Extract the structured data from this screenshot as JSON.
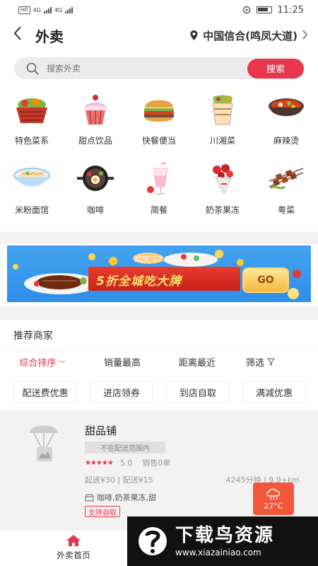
{
  "status_bar": {
    "left": "HD",
    "signal1": "4G",
    "signal2": "4G",
    "time": "11:25"
  },
  "header": {
    "back": "<",
    "title": "外卖",
    "location": "中国信合(鸣凤大道)"
  },
  "search": {
    "placeholder": "搜索外卖",
    "button": "搜索"
  },
  "categories": [
    {
      "label": "特色菜系",
      "icon": "basket-icon"
    },
    {
      "label": "甜点饮品",
      "icon": "cupcake-icon"
    },
    {
      "label": "快餐便当",
      "icon": "burger-icon"
    },
    {
      "label": "川湘菜",
      "icon": "salad-cup-icon"
    },
    {
      "label": "麻辣烫",
      "icon": "hotpot-icon"
    },
    {
      "label": "米粉面馆",
      "icon": "noodle-bowl-icon"
    },
    {
      "label": "咖啡",
      "icon": "sizzling-pan-icon"
    },
    {
      "label": "简餐",
      "icon": "drink-icon"
    },
    {
      "label": "奶茶果冻",
      "icon": "flower-bouquet-icon"
    },
    {
      "label": "粤菜",
      "icon": "skewer-icon"
    }
  ],
  "banner": {
    "sub": "欢庆 12.12",
    "main": "5折全城吃大牌",
    "go": "GO"
  },
  "recommend": {
    "title": "推荐商家"
  },
  "sorts": [
    "综合排序",
    "销量最高",
    "距离最近",
    "筛选"
  ],
  "filters": [
    "配送费优惠",
    "进店领券",
    "到店自取",
    "满减优惠"
  ],
  "shop": {
    "name": "甜品铺",
    "tag": "不在配送范围内",
    "stars": "★★★★★",
    "rating": "5.0",
    "sales": "销售0单",
    "delivery": "起送¥30 | 配送¥15",
    "distance": "4245分钟 | 9.9+km",
    "menu": "咖啡,奶茶果冻,甜",
    "pickup": "支持自取"
  },
  "weather": {
    "temp": "27°C"
  },
  "tabbar": {
    "home": "外卖首页"
  },
  "watermark": {
    "cn": "下载鸟资源",
    "url": "www.xiazainiao.com"
  },
  "colors": {
    "accent": "#e8364f",
    "weather": "#f2573a"
  }
}
